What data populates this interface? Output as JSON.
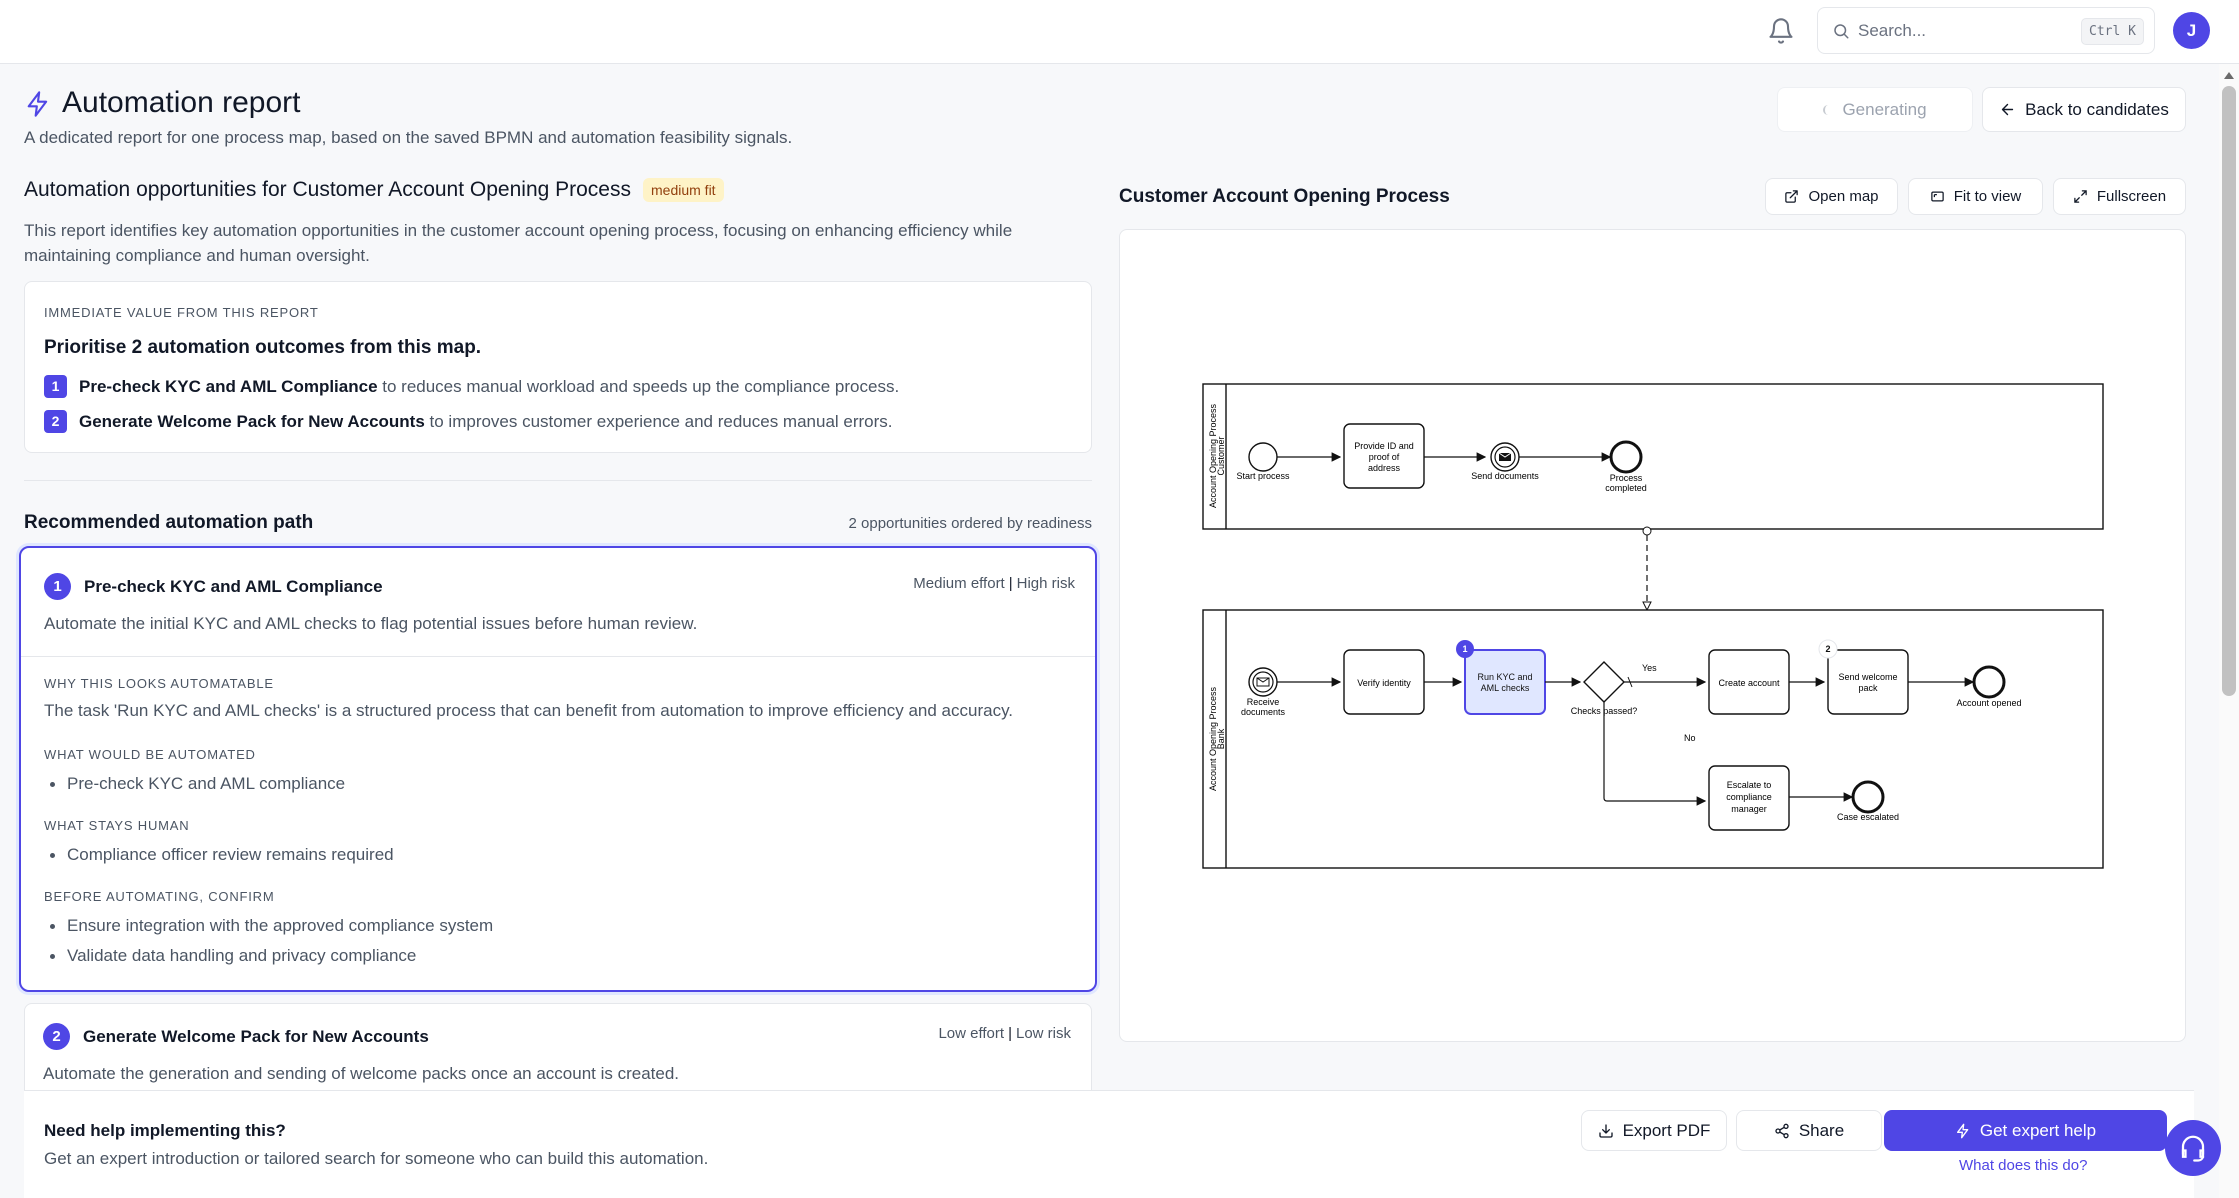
{
  "topbar": {
    "search_placeholder": "Search...",
    "search_shortcut": "Ctrl K",
    "avatar_initial": "J"
  },
  "header": {
    "title": "Automation report",
    "subtitle": "A dedicated report for one process map, based on the saved BPMN and automation feasibility signals.",
    "generating_label": "Generating",
    "back_label": "Back to candidates"
  },
  "report": {
    "heading": "Automation opportunities for Customer Account Opening Process",
    "fit_badge": "medium fit",
    "summary": "This report identifies key automation opportunities in the customer account opening process, focusing on enhancing efficiency while maintaining compliance and human oversight.",
    "value": {
      "eyebrow": "Immediate value from this report",
      "headline": "Prioritise 2 automation outcomes from this map.",
      "items": [
        {
          "num": "1",
          "title": "Pre-check KYC and AML Compliance",
          "rest": " to reduces manual workload and speeds up the compliance process."
        },
        {
          "num": "2",
          "title": "Generate Welcome Pack for New Accounts",
          "rest": " to improves customer experience and reduces manual errors."
        }
      ]
    },
    "path_heading": "Recommended automation path",
    "path_count": "2 opportunities ordered by readiness",
    "opportunities": [
      {
        "num": "1",
        "title": "Pre-check KYC and AML Compliance",
        "effort": "Medium effort",
        "risk": "High risk",
        "description": "Automate the initial KYC and AML checks to flag potential issues before human review.",
        "why_label": "Why this looks automatable",
        "why_text": "The task 'Run KYC and AML checks' is a structured process that can benefit from automation to improve efficiency and accuracy.",
        "automated_label": "What would be automated",
        "automated": [
          "Pre-check KYC and AML compliance"
        ],
        "human_label": "What stays human",
        "human": [
          "Compliance officer review remains required"
        ],
        "confirm_label": "Before automating, confirm",
        "confirm": [
          "Ensure integration with the approved compliance system",
          "Validate data handling and privacy compliance"
        ]
      },
      {
        "num": "2",
        "title": "Generate Welcome Pack for New Accounts",
        "effort": "Low effort",
        "risk": "Low risk",
        "description": "Automate the generation and sending of welcome packs once an account is created."
      }
    ]
  },
  "map": {
    "title": "Customer Account Opening Process",
    "open_label": "Open map",
    "fit_label": "Fit to view",
    "fullscreen_label": "Fullscreen",
    "pool1": {
      "name": "Account Opening Process",
      "lane": "Customer"
    },
    "pool2": {
      "name": "Account Opening Process",
      "lane": "Bank"
    },
    "labels": {
      "start": "Start process",
      "provide": [
        "Provide ID and",
        "proof of",
        "address"
      ],
      "send_docs": "Send documents",
      "completed": [
        "Process",
        "completed"
      ],
      "receive": [
        "Receive",
        "documents"
      ],
      "verify": "Verify identity",
      "kyc": [
        "Run KYC and",
        "AML checks"
      ],
      "checks": "Checks passed?",
      "yes": "Yes",
      "no": "No",
      "create": "Create account",
      "welcome": [
        "Send welcome",
        "pack"
      ],
      "opened": "Account opened",
      "escalate": [
        "Escalate to",
        "compliance",
        "manager"
      ],
      "escalated": "Case escalated",
      "marker1": "1",
      "marker2": "2"
    }
  },
  "footer": {
    "title": "Need help implementing this?",
    "description": "Get an expert introduction or tailored search for someone who can build this automation.",
    "export_label": "Export PDF",
    "share_label": "Share",
    "expert_label": "Get expert help",
    "what_link": "What does this do?"
  },
  "colors": {
    "accent": "#4f46e5",
    "badge_bg": "#fef3c7",
    "badge_text": "#92400e"
  }
}
